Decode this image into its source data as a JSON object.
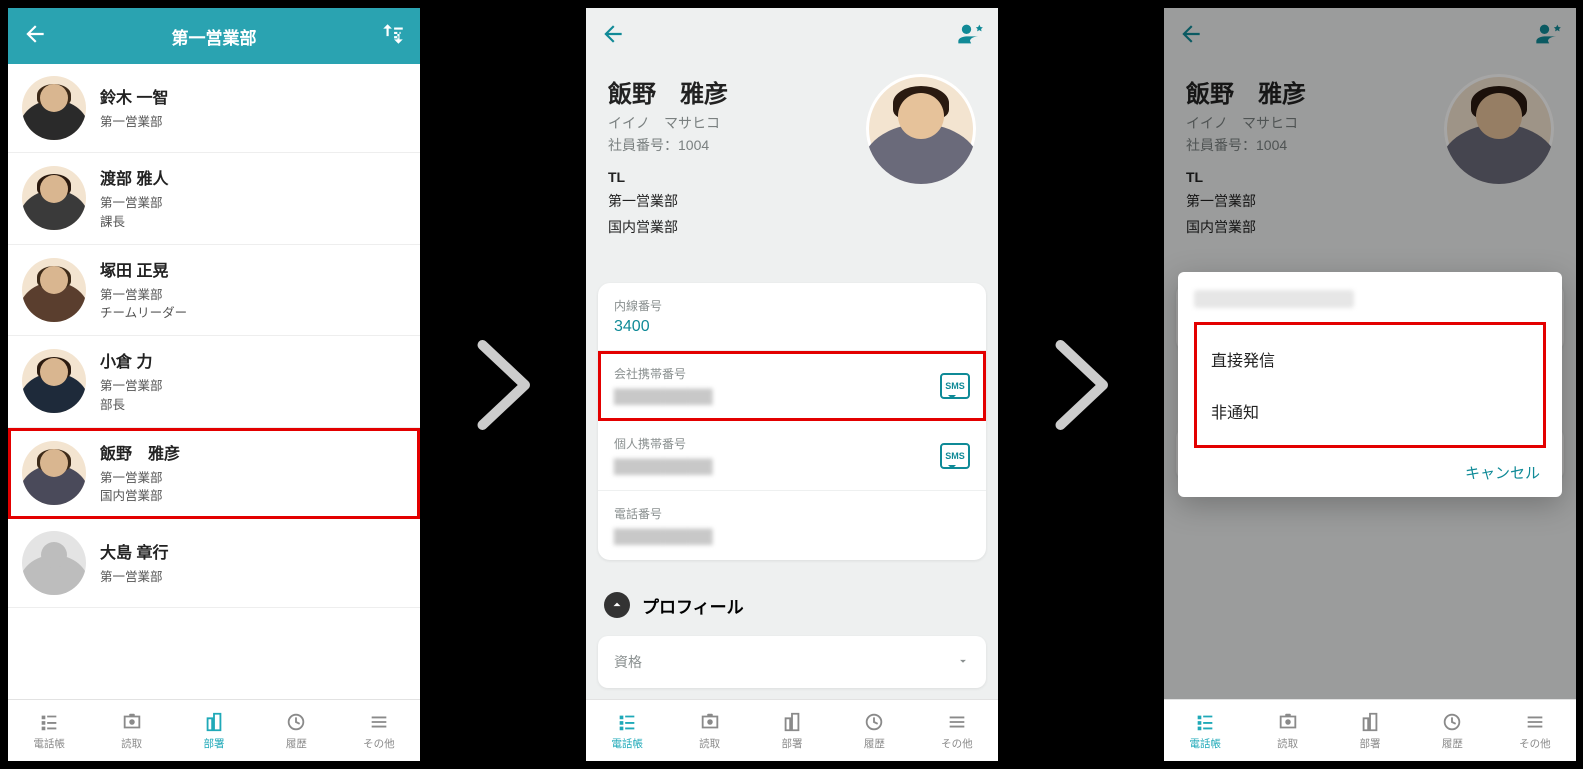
{
  "screen1": {
    "title": "第一営業部",
    "contacts": [
      {
        "name": "鈴木 一智",
        "lines": [
          "第一営業部"
        ]
      },
      {
        "name": "渡部 雅人",
        "lines": [
          "第一営業部",
          "課長"
        ]
      },
      {
        "name": "塚田 正晃",
        "lines": [
          "第一営業部",
          "チームリーダー"
        ]
      },
      {
        "name": "小倉 力",
        "lines": [
          "第一営業部",
          "部長"
        ]
      },
      {
        "name": "飯野　雅彦",
        "lines": [
          "第一営業部",
          "国内営業部"
        ],
        "highlight": true
      },
      {
        "name": "大島 章行",
        "lines": [
          "第一営業部"
        ],
        "placeholder": true
      }
    ]
  },
  "screen2": {
    "name": "飯野　雅彦",
    "kana": "イイノ　マサヒコ",
    "empno_label": "社員番号：1004",
    "role": "TL",
    "dept1": "第一営業部",
    "dept2": "国内営業部",
    "fields": [
      {
        "label": "内線番号",
        "value": "3400"
      },
      {
        "label": "会社携帯番号",
        "value": "▇▇▇▇▇▇▇▇",
        "sms": true,
        "blur": true,
        "highlight": true
      },
      {
        "label": "個人携帯番号",
        "value": "▇▇▇▇▇▇▇▇",
        "sms": true,
        "blur": true
      },
      {
        "label": "電話番号",
        "value": "▇▇▇▇▇▇▇▇",
        "blur": true
      }
    ],
    "profile_title": "プロフィール",
    "profile_sub": "資格"
  },
  "screen3": {
    "opt1": "直接発信",
    "opt2": "非通知",
    "cancel": "キャンセル"
  },
  "tabs": [
    {
      "label": "電話帳"
    },
    {
      "label": "読取"
    },
    {
      "label": "部署"
    },
    {
      "label": "履歴"
    },
    {
      "label": "その他"
    }
  ]
}
